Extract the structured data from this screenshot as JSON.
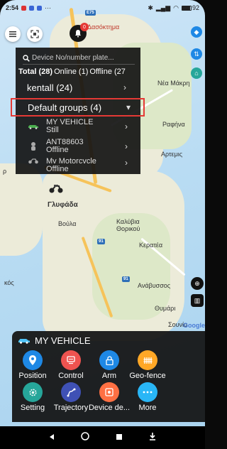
{
  "status_bar": {
    "time": "2:54",
    "battery": "92"
  },
  "map": {
    "road_shields": [
      "E75",
      "91",
      "91"
    ],
    "places": [
      "Δασόκτημα",
      "Νέα Μάκρη",
      "Ραφήνα",
      "Αρτεμις",
      "Γλυφάδα",
      "Βούλα",
      "Καλύβια Θορικού",
      "Κερατέα",
      "Ανάβυσσος",
      "Θυμάρι",
      "Σουνίο",
      "κός",
      "ρ",
      "Google"
    ]
  },
  "header": {
    "notification_badge": "0"
  },
  "dropdown": {
    "search_placeholder": "Device No/number plate...",
    "filters": [
      "Total (28)",
      "Online (1)",
      "Offline (27"
    ],
    "groups": [
      {
        "label": "kentall (24)",
        "chevron": "›"
      },
      {
        "label": "Default groups (4)",
        "chevron": "▾"
      }
    ],
    "vehicles": [
      {
        "name": "MY VEHICLE",
        "status": "Still"
      },
      {
        "name": "ANT88603",
        "status": "Offline"
      },
      {
        "name": "Mv Motorcvcle",
        "status": "Offline"
      }
    ]
  },
  "panel": {
    "title": "MY VEHICLE",
    "actions": [
      {
        "label": "Position",
        "icon": "location-pin-icon",
        "color": "#1e88e5"
      },
      {
        "label": "Control",
        "icon": "control-screen-icon",
        "color": "#ef5350"
      },
      {
        "label": "Arm",
        "icon": "lock-icon",
        "color": "#1e88e5"
      },
      {
        "label": "Geo-fence",
        "icon": "geofence-icon",
        "color": "#ffa726"
      },
      {
        "label": "Setting",
        "icon": "gear-icon",
        "color": "#26a69a"
      },
      {
        "label": "Trajectory",
        "icon": "trajectory-icon",
        "color": "#3f51b5"
      },
      {
        "label": "Device de...",
        "icon": "device-details-icon",
        "color": "#ff7043"
      },
      {
        "label": "More",
        "icon": "more-dots-icon",
        "color": "#29b6f6"
      }
    ]
  },
  "colors": {
    "highlight_border": "#e53935",
    "dropdown_bg": "#141414",
    "accent": "#1e88e5"
  }
}
